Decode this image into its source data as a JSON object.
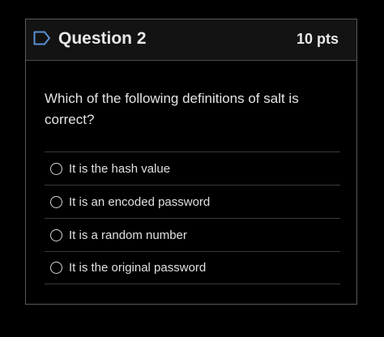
{
  "question": {
    "title": "Question 2",
    "points": "10 pts",
    "prompt": "Which of the following definitions of salt is correct?",
    "flag_icon": "flag-outline-icon"
  },
  "answers": [
    {
      "label": "It is the hash value",
      "selected": false
    },
    {
      "label": "It is an encoded password",
      "selected": false
    },
    {
      "label": "It is a random number",
      "selected": false
    },
    {
      "label": "It is the original password",
      "selected": false
    }
  ],
  "colors": {
    "background": "#000000",
    "header_bg": "#131313",
    "accent_flag": "#5b8fd6",
    "text": "#e8e8e8"
  }
}
